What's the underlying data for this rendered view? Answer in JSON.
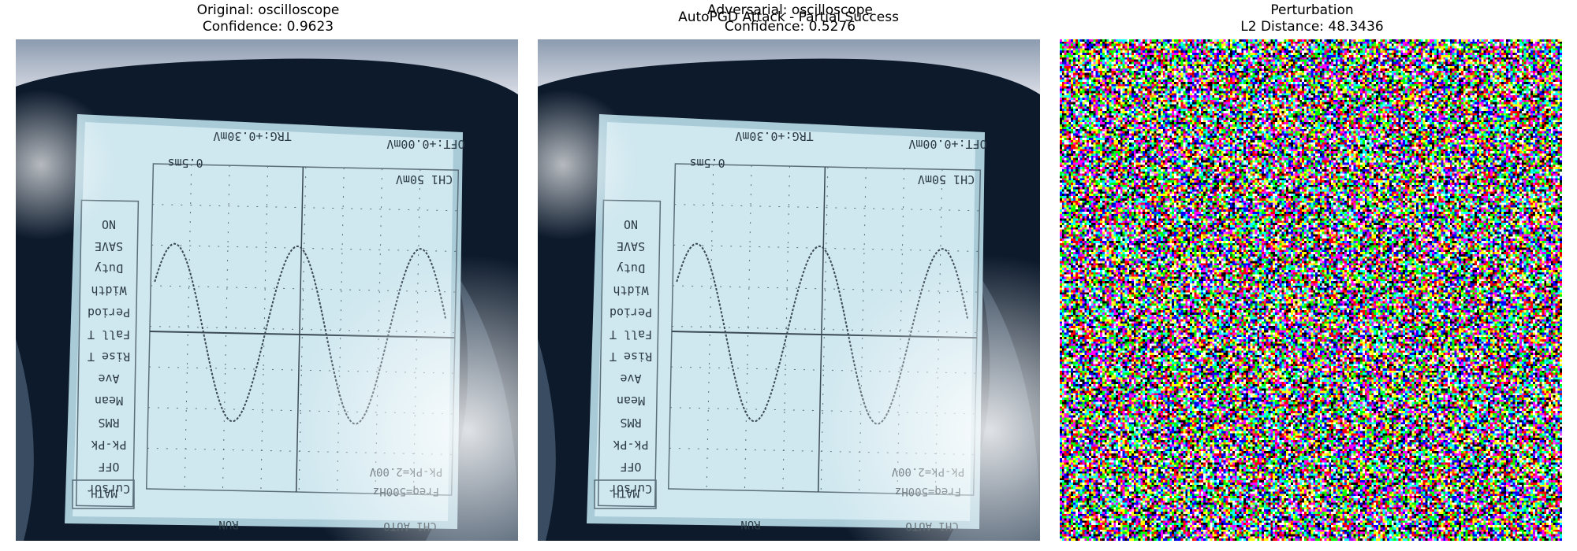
{
  "figure": {
    "suptitle": "AutoPGD Attack - Partial Success"
  },
  "panels": [
    {
      "title_line1": "Original: oscilloscope",
      "title_line2": "Confidence: 0.9623",
      "image_type": "photo-oscilloscope"
    },
    {
      "title_line1": "Adversarial: oscilloscope",
      "title_line2": "Confidence: 0.5276",
      "image_type": "photo-oscilloscope"
    },
    {
      "title_line1": "Perturbation",
      "title_line2": "L2 Distance: 48.3436",
      "image_type": "noise"
    }
  ],
  "colors": {
    "bezel": "#0c1a2c",
    "screen": "#cfe7ef",
    "screen_edge": "#a9cbd8",
    "trace": "#3a4a55",
    "grid": "#5b6f7b"
  }
}
